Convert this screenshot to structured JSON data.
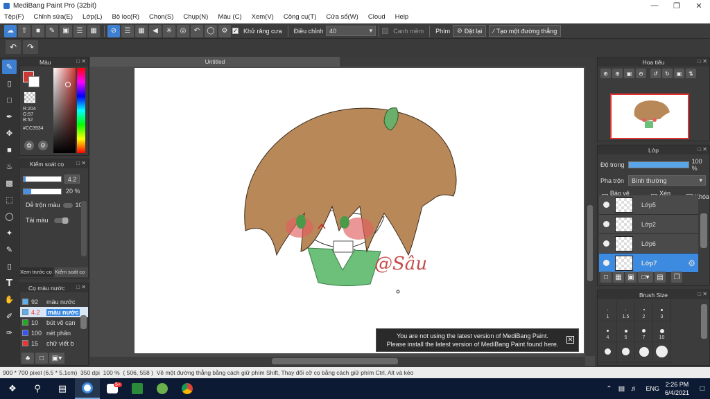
{
  "window": {
    "title": "MediBang Paint Pro (32bit)"
  },
  "menu": [
    "Tệp(F)",
    "Chỉnh sửa(E)",
    "Lớp(L)",
    "Bộ lọc(R)",
    "Chọn(S)",
    "Chụp(N)",
    "Màu (C)",
    "Xem(V)",
    "Công cụ(T)",
    "Cửa sổ(W)",
    "Cloud",
    "Help"
  ],
  "toolbar": {
    "antialias_label": "Khử răng cưa",
    "adjust_label": "Điều chỉnh",
    "adjust_value": "40",
    "smooth_label": "Canh mềm",
    "pen_label": "Phím",
    "reset_label": "Đặt lại",
    "line_label": "Tạo một đường thẳng"
  },
  "color_panel": {
    "title": "Màu",
    "r": "R:204",
    "g": "G:57",
    "b": "B:52",
    "hex": "#CC3934",
    "primary": "#cc3934"
  },
  "brush_control": {
    "title": "Kiểm soát cọ",
    "size": "4.2",
    "opacity": "20 %",
    "mix_label": "Dễ trộn màu",
    "mix_value": "10",
    "color_label": "Tải màu",
    "tab_preview": "Xem trước cọ",
    "tab_control": "Kiểm soát cọ"
  },
  "brush_list": {
    "title": "Cọ màu nước",
    "items": [
      {
        "size": "92",
        "name": "màu nước",
        "color": "#5ab0f0"
      },
      {
        "size": "4.2",
        "name": "màu nước",
        "color": "#5ab0f0"
      },
      {
        "size": "10",
        "name": "bút vẽ cạn",
        "color": "#22aa22"
      },
      {
        "size": "100",
        "name": "nét phân",
        "color": "#3355ff"
      },
      {
        "size": "15",
        "name": "chữ viết b",
        "color": "#ee3333"
      }
    ]
  },
  "canvas": {
    "tab": "Untitled",
    "signature": "@Sâu"
  },
  "navigator": {
    "title": "Hoa tiêu"
  },
  "layer_panel": {
    "title": "Lớp",
    "opacity_label": "Độ trong",
    "opacity_value": "100 %",
    "opacity": 1,
    "blend_label": "Pha trộn",
    "blend_value": "Bình thường",
    "protect_alpha": "Bảo vệ alpha",
    "clip": "Xén bớt",
    "lock": "Khóa",
    "layers": [
      {
        "name": "Lớp5",
        "active": false
      },
      {
        "name": "Lớp2",
        "active": false
      },
      {
        "name": "Lớp6",
        "active": false
      },
      {
        "name": "Lớp7",
        "active": true
      }
    ]
  },
  "brush_size": {
    "title": "Brush Size",
    "row1": [
      "1",
      "1.5",
      "2",
      "3"
    ],
    "row2": [
      "4",
      "5",
      "7",
      "10"
    ]
  },
  "toast": {
    "line1": "You are not using the latest version of MediBang Paint.",
    "line2": "Please install the latest version of MediBang Paint found here."
  },
  "status": {
    "size": "900 * 700 pixel",
    "cm": "(6.5 * 5.1cm)",
    "dpi": "350 dpi",
    "zoom": "100 %",
    "coord": "( 506, 558 )",
    "hint": "Vẽ một đường thẳng bằng cách giữ phím Shift, Thay đổi cỡ cọ bằng cách giữ phím Ctrl, Alt và kéo"
  },
  "taskbar": {
    "lang": "ENG",
    "time": "2:26 PM",
    "date": "6/4/2021",
    "badge": "5+"
  }
}
